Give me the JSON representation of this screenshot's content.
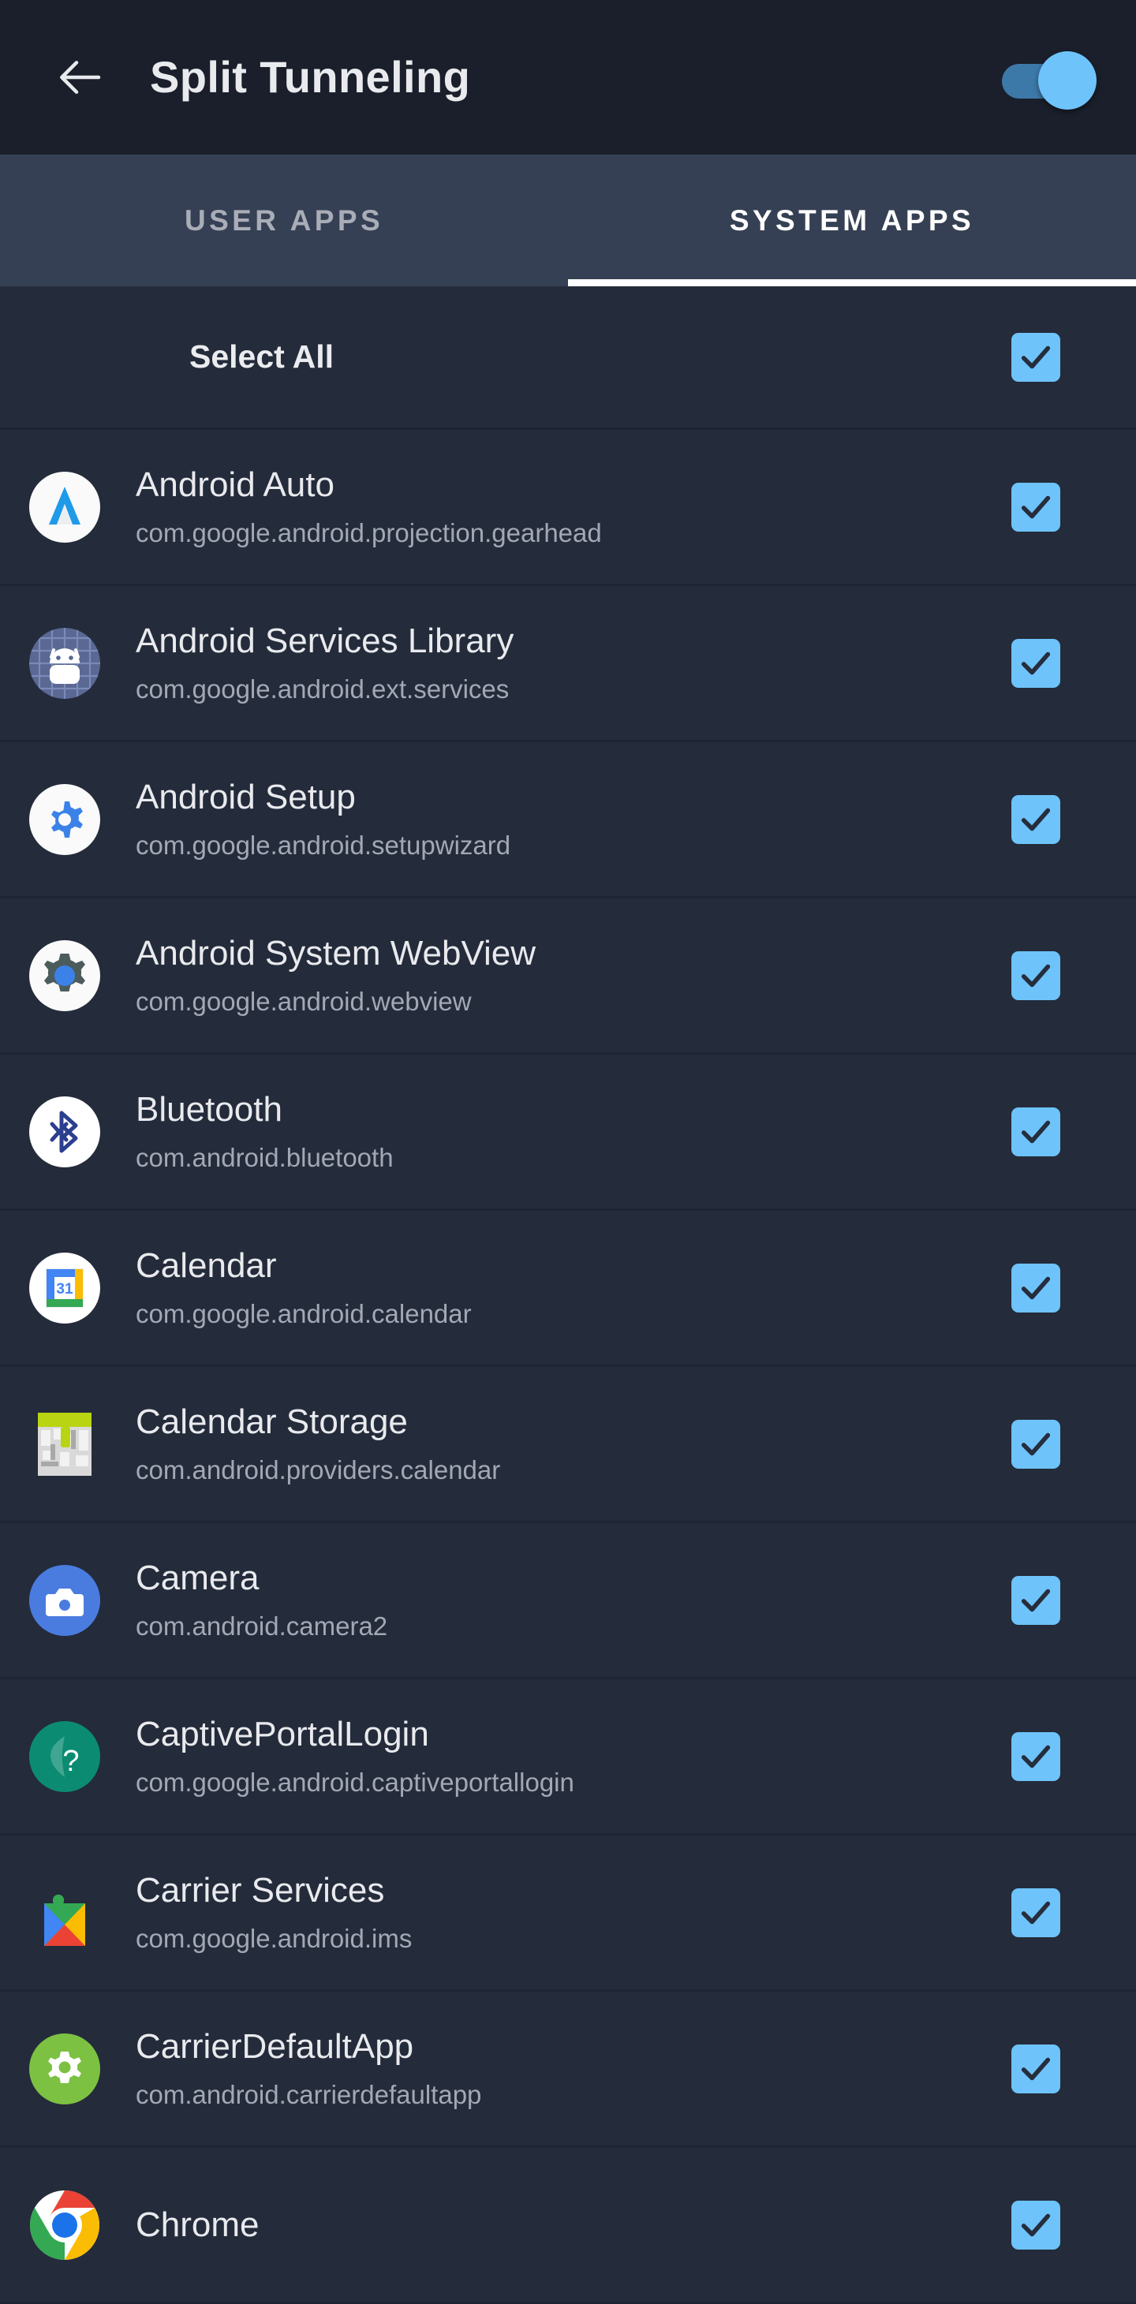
{
  "header": {
    "back_icon": "arrow-left-icon",
    "title": "Split Tunneling",
    "toggle_state": "on",
    "toggle_thumb_color": "#6ec3fa",
    "toggle_track_color": "#3d79a8",
    "background_color": "#1a1f2b"
  },
  "tabs": {
    "background_color": "#364054",
    "indicator_color": "#ffffff",
    "items": [
      {
        "label": "USER APPS",
        "active": false
      },
      {
        "label": "SYSTEM APPS",
        "active": true
      }
    ]
  },
  "list": {
    "background_color": "#242b3a",
    "checkbox_color": "#6ec3fa",
    "select_all": {
      "label": "Select All",
      "checked": true
    },
    "apps": [
      {
        "name": "Android Auto",
        "package": "com.google.android.projection.gearhead",
        "icon": "android-auto-icon",
        "checked": true
      },
      {
        "name": "Android Services Library",
        "package": "com.google.android.ext.services",
        "icon": "android-services-library-icon",
        "checked": true
      },
      {
        "name": "Android Setup",
        "package": "com.google.android.setupwizard",
        "icon": "android-setup-gear-icon",
        "checked": true
      },
      {
        "name": "Android System WebView",
        "package": "com.google.android.webview",
        "icon": "android-webview-icon",
        "checked": true
      },
      {
        "name": "Bluetooth",
        "package": "com.android.bluetooth",
        "icon": "bluetooth-icon",
        "checked": true
      },
      {
        "name": "Calendar",
        "package": "com.google.android.calendar",
        "icon": "google-calendar-icon",
        "checked": true
      },
      {
        "name": "Calendar Storage",
        "package": "com.android.providers.calendar",
        "icon": "calendar-storage-icon",
        "checked": true
      },
      {
        "name": "Camera",
        "package": "com.android.camera2",
        "icon": "camera-icon",
        "checked": true
      },
      {
        "name": "CaptivePortalLogin",
        "package": "com.google.android.captiveportallogin",
        "icon": "captive-portal-question-icon",
        "checked": true
      },
      {
        "name": "Carrier Services",
        "package": "com.google.android.ims",
        "icon": "google-play-services-puzzle-icon",
        "checked": true
      },
      {
        "name": "CarrierDefaultApp",
        "package": "com.android.carrierdefaultapp",
        "icon": "carrier-default-gear-icon",
        "checked": true
      },
      {
        "name": "Chrome",
        "package": "",
        "icon": "chrome-icon",
        "checked": true
      }
    ]
  }
}
